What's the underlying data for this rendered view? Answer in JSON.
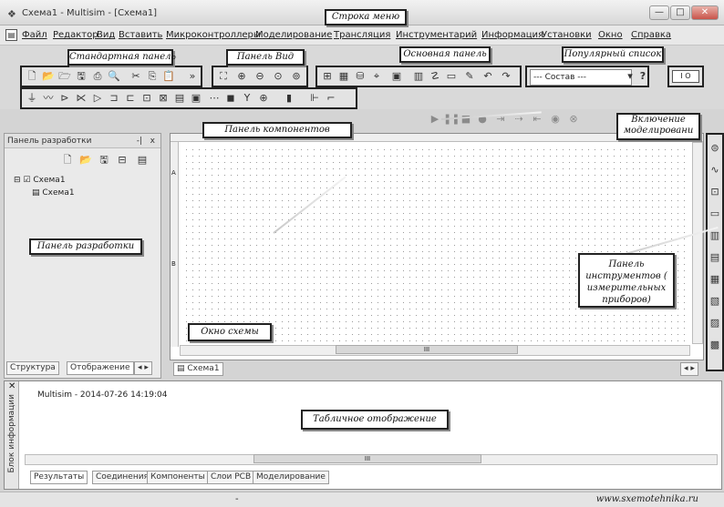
{
  "window": {
    "title": "Схема1 - Multisim - [Схема1]",
    "controls": {
      "minimize": "—",
      "maximize": "□",
      "close": "✕"
    }
  },
  "menubar": {
    "items": [
      "Файл",
      "Редактор",
      "Вид",
      "Вставить",
      "Микроконтроллеры",
      "Моделирование",
      "Трансляция",
      "Инструментарий",
      "Информация",
      "Установки",
      "Окно",
      "Справка"
    ],
    "mdi_controls": "▣ ✕"
  },
  "toolbars": {
    "component_select": "--- Состав ---",
    "help_glyph": "?",
    "sim_switch": "I O"
  },
  "callouts": {
    "menu_bar": "Строка меню",
    "standard_panel": "Стандартная панель",
    "view_panel": "Панель Вид",
    "main_panel": "Основная панель",
    "popular_list": "Популярный список",
    "components_panel": "Панель компонентов",
    "sim_switch": "Включение моделировани",
    "design_panel": "Панель разработки",
    "instruments_panel": "Панель инструментов ( измерительных приборов)",
    "schematic_window": "Окно схемы",
    "spreadsheet": "Табличное отображение"
  },
  "design_toolbox": {
    "title": "Панель разработки",
    "close": "x",
    "pin": "-|",
    "tree_root": "Схема1",
    "tree_child": "Схема1",
    "tabs": [
      "Структура",
      "Отображение"
    ],
    "tab_nav": "◂ ▸"
  },
  "schematic": {
    "tab": "Схема1",
    "ruler_marks": [
      "A",
      "B"
    ],
    "scroll_label": "III"
  },
  "spreadsheet": {
    "side_label": "Блок информации",
    "log_line": "Multisim  -  2014-07-26 14:19:04",
    "scroll_label": "III",
    "tabs": [
      "Результаты",
      "Соединения",
      "Компоненты",
      "Слои PCB",
      "Моделирование"
    ]
  },
  "statusbar": {
    "watermark": "www.sxemotehnika.ru",
    "dash": "-"
  }
}
